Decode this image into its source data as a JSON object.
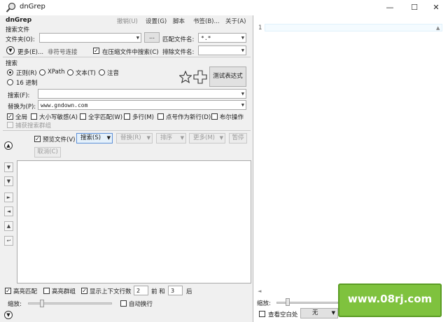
{
  "window": {
    "title": "dnGrep",
    "min": "—",
    "max": "☐",
    "close": "✕"
  },
  "app": {
    "name": "dnGrep"
  },
  "menu": [
    "撤销(U)",
    "设置(G)",
    "脚本",
    "书签(B)...",
    "关于(A)"
  ],
  "search_files": {
    "section": "搜索文件",
    "folder_label": "文件夹(O):",
    "folder_value": "",
    "browse": "...",
    "match_label": "匹配文件名:",
    "match_value": "*.*",
    "more_label": "更多(E)...",
    "nonsymlink_label": "非符号连接",
    "archive_label": "在压缩文件中搜索(C)",
    "exclude_label": "排除文件名:",
    "exclude_value": ""
  },
  "search": {
    "section": "搜索",
    "radios": [
      "正则(R)",
      "XPath",
      "文本(T)",
      "注音"
    ],
    "hex_label": "16 进制",
    "test_button": "测试表达式",
    "search_label": "搜索(F):",
    "search_value": "",
    "replace_label": "替换为(P):",
    "replace_value": "www.gndown.com",
    "options": [
      "全局",
      "大小写敏感(A)",
      "全字匹配(W)",
      "多行(M)",
      "点号作为新行(D)",
      "布尔操作"
    ],
    "capture_group": "捕获搜索群组"
  },
  "toolbar": {
    "preview": "预览文件(V)",
    "search": "搜索(S)",
    "replace": "替换(R)",
    "sort": "排序",
    "more": "更多(M)",
    "pause": "暂停",
    "cancel": "取消(C)"
  },
  "sidebar_icons": [
    "▼",
    "▼",
    "►",
    "◄",
    "▲",
    "↩"
  ],
  "bottom": {
    "highlight": "高亮匹配",
    "highlight_group": "高亮群组",
    "show_context": "显示上下文行数",
    "before_value": "2",
    "before_label": "前 和",
    "after_value": "3",
    "after_label": "后",
    "zoom_label": "缩放:",
    "wrap_label": "自动换行"
  },
  "right": {
    "line_number": "1",
    "zoom_label": "缩放:",
    "whitespace_label": "查看空白处",
    "none_value": "无"
  },
  "watermark": "www.08rj.com"
}
